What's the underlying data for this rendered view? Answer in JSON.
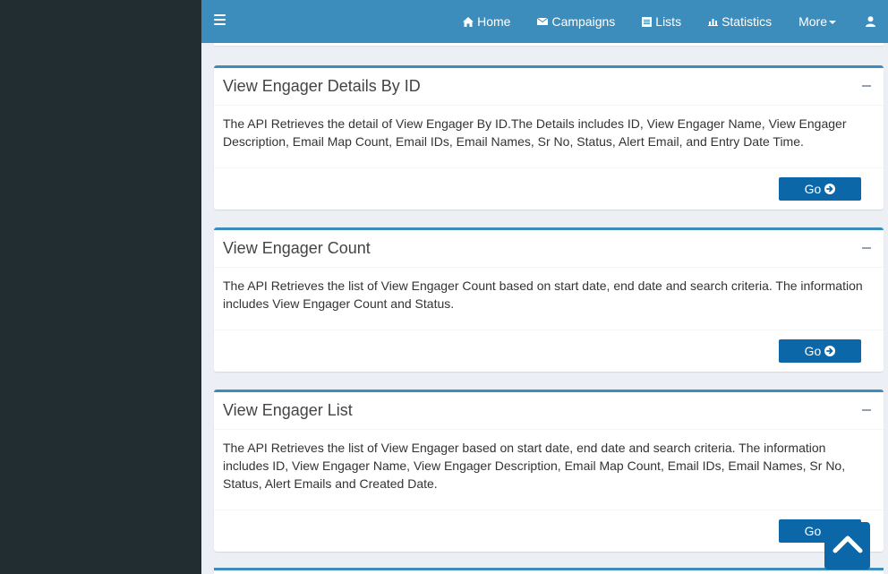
{
  "nav": {
    "home": "Home",
    "campaigns": "Campaigns",
    "lists": "Lists",
    "statistics": "Statistics",
    "more": "More"
  },
  "boxes": [
    {
      "title": "View Engager Details By ID",
      "body": "The API Retrieves the detail of View Engager By ID.The Details includes ID, View Engager Name, View Engager Description, Email Map Count, Email IDs, Email Names, Sr No, Status, Alert Email, and Entry Date Time.",
      "button": "Go"
    },
    {
      "title": "View Engager Count",
      "body": "The API Retrieves the list of View Engager Count based on start date, end date and search criteria. The information includes View Engager Count and Status.",
      "button": "Go"
    },
    {
      "title": "View Engager List",
      "body": "The API Retrieves the list of View Engager based on start date, end date and search criteria. The information includes ID, View Engager Name, View Engager Description, Email Map Count, Email IDs, Email Names, Sr No, Status, Alert Emails and Created Date.",
      "button": "Go"
    }
  ],
  "colors": {
    "navbar": "#3c8dbc",
    "sidebar": "#222d32",
    "button": "#0b67a8",
    "background": "#ecf0f5"
  }
}
